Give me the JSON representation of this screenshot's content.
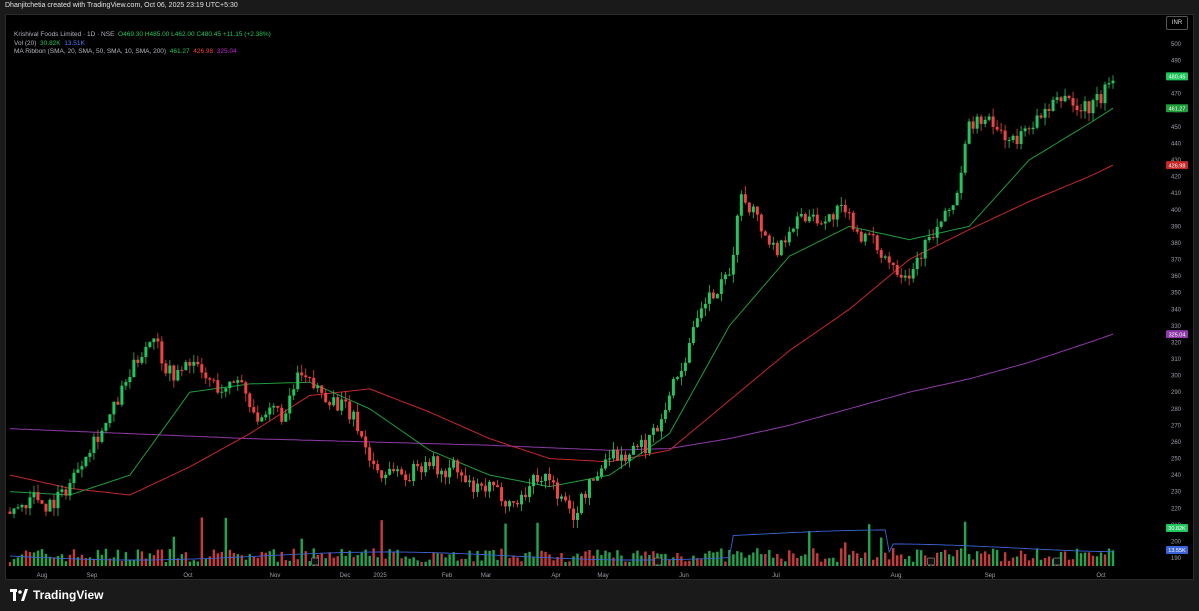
{
  "header": {
    "attribution": "Dhanjitchetia created with TradingView.com, Oct 06, 2025 23:19 UTC+5:30"
  },
  "legend": {
    "symbol": "Krishival Foods Limited · 1D · NSE",
    "ohlc": "O469.30  H485.00  L462.00  C480.45  +11.15 (+2.38%)",
    "vol_label": "Vol (20)",
    "vol_value": "30.82K",
    "vol_ma": "13.51K",
    "ma_label": "MA Ribbon (SMA, 20, SMA, 50, SMA, 10, SMA, 200)",
    "ma_values": [
      "461.27",
      "426.98",
      "325.04"
    ]
  },
  "currency_button": "INR",
  "footer": {
    "brand": "TradingView"
  },
  "colors": {
    "up": "#22c55e",
    "down": "#ef4444",
    "ma20": "#1f9d3a",
    "ma50": "#c62828",
    "ma200": "#8e3aa8",
    "vol_ma": "#3b63d6"
  },
  "chart_data": {
    "type": "candlestick",
    "title": "Krishival Foods Limited · 1D · NSE",
    "x_tick_labels": [
      "Aug",
      "Sep",
      "Oct",
      "Nov",
      "Dec",
      "2025",
      "Feb",
      "Mar",
      "Apr",
      "May",
      "Jun",
      "Jul",
      "Aug",
      "Sep",
      "Oct"
    ],
    "y_tick_labels": [
      500,
      490,
      480,
      470,
      460,
      450,
      440,
      430,
      420,
      410,
      400,
      390,
      380,
      370,
      360,
      350,
      340,
      330,
      320,
      310,
      300,
      290,
      280,
      270,
      260,
      250,
      240,
      230,
      220,
      210,
      200,
      190
    ],
    "ylim": [
      190,
      500
    ],
    "price_badges": [
      {
        "label": "480.45",
        "value": 480.45,
        "color": "#22c55e"
      },
      {
        "label": "461.27",
        "value": 461.27,
        "color": "#1f9d3a"
      },
      {
        "label": "426.98",
        "value": 426.98,
        "color": "#c62828"
      },
      {
        "label": "325.04",
        "value": 325.04,
        "color": "#8e3aa8"
      }
    ],
    "volume_badges": [
      {
        "label": "30.82K",
        "color": "#22c55e"
      },
      {
        "label": "13.55K",
        "color": "#3b63d6"
      }
    ],
    "price_anchors": [
      [
        0,
        218
      ],
      [
        3,
        222
      ],
      [
        6,
        228
      ],
      [
        9,
        222
      ],
      [
        12,
        226
      ],
      [
        15,
        235
      ],
      [
        18,
        250
      ],
      [
        21,
        262
      ],
      [
        24,
        270
      ],
      [
        27,
        285
      ],
      [
        30,
        300
      ],
      [
        33,
        315
      ],
      [
        36,
        325
      ],
      [
        39,
        305
      ],
      [
        42,
        300
      ],
      [
        45,
        310
      ],
      [
        48,
        300
      ],
      [
        51,
        295
      ],
      [
        54,
        290
      ],
      [
        57,
        300
      ],
      [
        60,
        285
      ],
      [
        63,
        270
      ],
      [
        66,
        280
      ],
      [
        69,
        275
      ],
      [
        72,
        300
      ],
      [
        75,
        295
      ],
      [
        78,
        290
      ],
      [
        81,
        285
      ],
      [
        84,
        280
      ],
      [
        87,
        270
      ],
      [
        90,
        250
      ],
      [
        93,
        240
      ],
      [
        96,
        245
      ],
      [
        99,
        238
      ],
      [
        102,
        245
      ],
      [
        105,
        250
      ],
      [
        108,
        240
      ],
      [
        111,
        245
      ],
      [
        114,
        235
      ],
      [
        117,
        230
      ],
      [
        120,
        232
      ],
      [
        123,
        228
      ],
      [
        126,
        222
      ],
      [
        129,
        230
      ],
      [
        132,
        240
      ],
      [
        135,
        238
      ],
      [
        138,
        225
      ],
      [
        141,
        215
      ],
      [
        144,
        230
      ],
      [
        147,
        240
      ],
      [
        150,
        255
      ],
      [
        153,
        250
      ],
      [
        156,
        255
      ],
      [
        159,
        258
      ],
      [
        162,
        270
      ],
      [
        165,
        290
      ],
      [
        168,
        305
      ],
      [
        171,
        325
      ],
      [
        174,
        345
      ],
      [
        177,
        350
      ],
      [
        180,
        360
      ],
      [
        183,
        410
      ],
      [
        186,
        400
      ],
      [
        189,
        385
      ],
      [
        192,
        375
      ],
      [
        195,
        390
      ],
      [
        198,
        395
      ],
      [
        201,
        398
      ],
      [
        204,
        392
      ],
      [
        207,
        400
      ],
      [
        210,
        395
      ],
      [
        213,
        385
      ],
      [
        216,
        380
      ],
      [
        219,
        372
      ],
      [
        222,
        365
      ],
      [
        225,
        362
      ],
      [
        228,
        375
      ],
      [
        231,
        385
      ],
      [
        234,
        395
      ],
      [
        237,
        410
      ],
      [
        240,
        450
      ],
      [
        243,
        455
      ],
      [
        246,
        450
      ],
      [
        249,
        445
      ],
      [
        252,
        440
      ],
      [
        255,
        452
      ],
      [
        258,
        455
      ],
      [
        261,
        462
      ],
      [
        264,
        470
      ],
      [
        267,
        460
      ],
      [
        270,
        462
      ],
      [
        273,
        468
      ],
      [
        276,
        480
      ]
    ],
    "ma_20_anchors": [
      [
        0,
        230
      ],
      [
        15,
        228
      ],
      [
        30,
        240
      ],
      [
        45,
        290
      ],
      [
        60,
        295
      ],
      [
        75,
        296
      ],
      [
        90,
        280
      ],
      [
        105,
        255
      ],
      [
        120,
        240
      ],
      [
        135,
        233
      ],
      [
        150,
        240
      ],
      [
        165,
        265
      ],
      [
        180,
        330
      ],
      [
        195,
        372
      ],
      [
        210,
        390
      ],
      [
        225,
        382
      ],
      [
        240,
        390
      ],
      [
        255,
        430
      ],
      [
        270,
        452
      ],
      [
        276,
        461.27
      ]
    ],
    "ma_50_anchors": [
      [
        0,
        240
      ],
      [
        15,
        232
      ],
      [
        30,
        228
      ],
      [
        45,
        245
      ],
      [
        60,
        265
      ],
      [
        75,
        288
      ],
      [
        90,
        292
      ],
      [
        105,
        278
      ],
      [
        120,
        262
      ],
      [
        135,
        250
      ],
      [
        150,
        248
      ],
      [
        165,
        255
      ],
      [
        180,
        285
      ],
      [
        195,
        315
      ],
      [
        210,
        340
      ],
      [
        225,
        370
      ],
      [
        240,
        388
      ],
      [
        255,
        405
      ],
      [
        270,
        420
      ],
      [
        276,
        426.98
      ]
    ],
    "ma_200_anchors": [
      [
        0,
        268
      ],
      [
        30,
        265
      ],
      [
        60,
        262
      ],
      [
        90,
        260
      ],
      [
        120,
        258
      ],
      [
        150,
        255
      ],
      [
        165,
        256
      ],
      [
        180,
        262
      ],
      [
        195,
        270
      ],
      [
        210,
        280
      ],
      [
        225,
        290
      ],
      [
        240,
        298
      ],
      [
        255,
        308
      ],
      [
        270,
        320
      ],
      [
        276,
        325.04
      ]
    ]
  }
}
